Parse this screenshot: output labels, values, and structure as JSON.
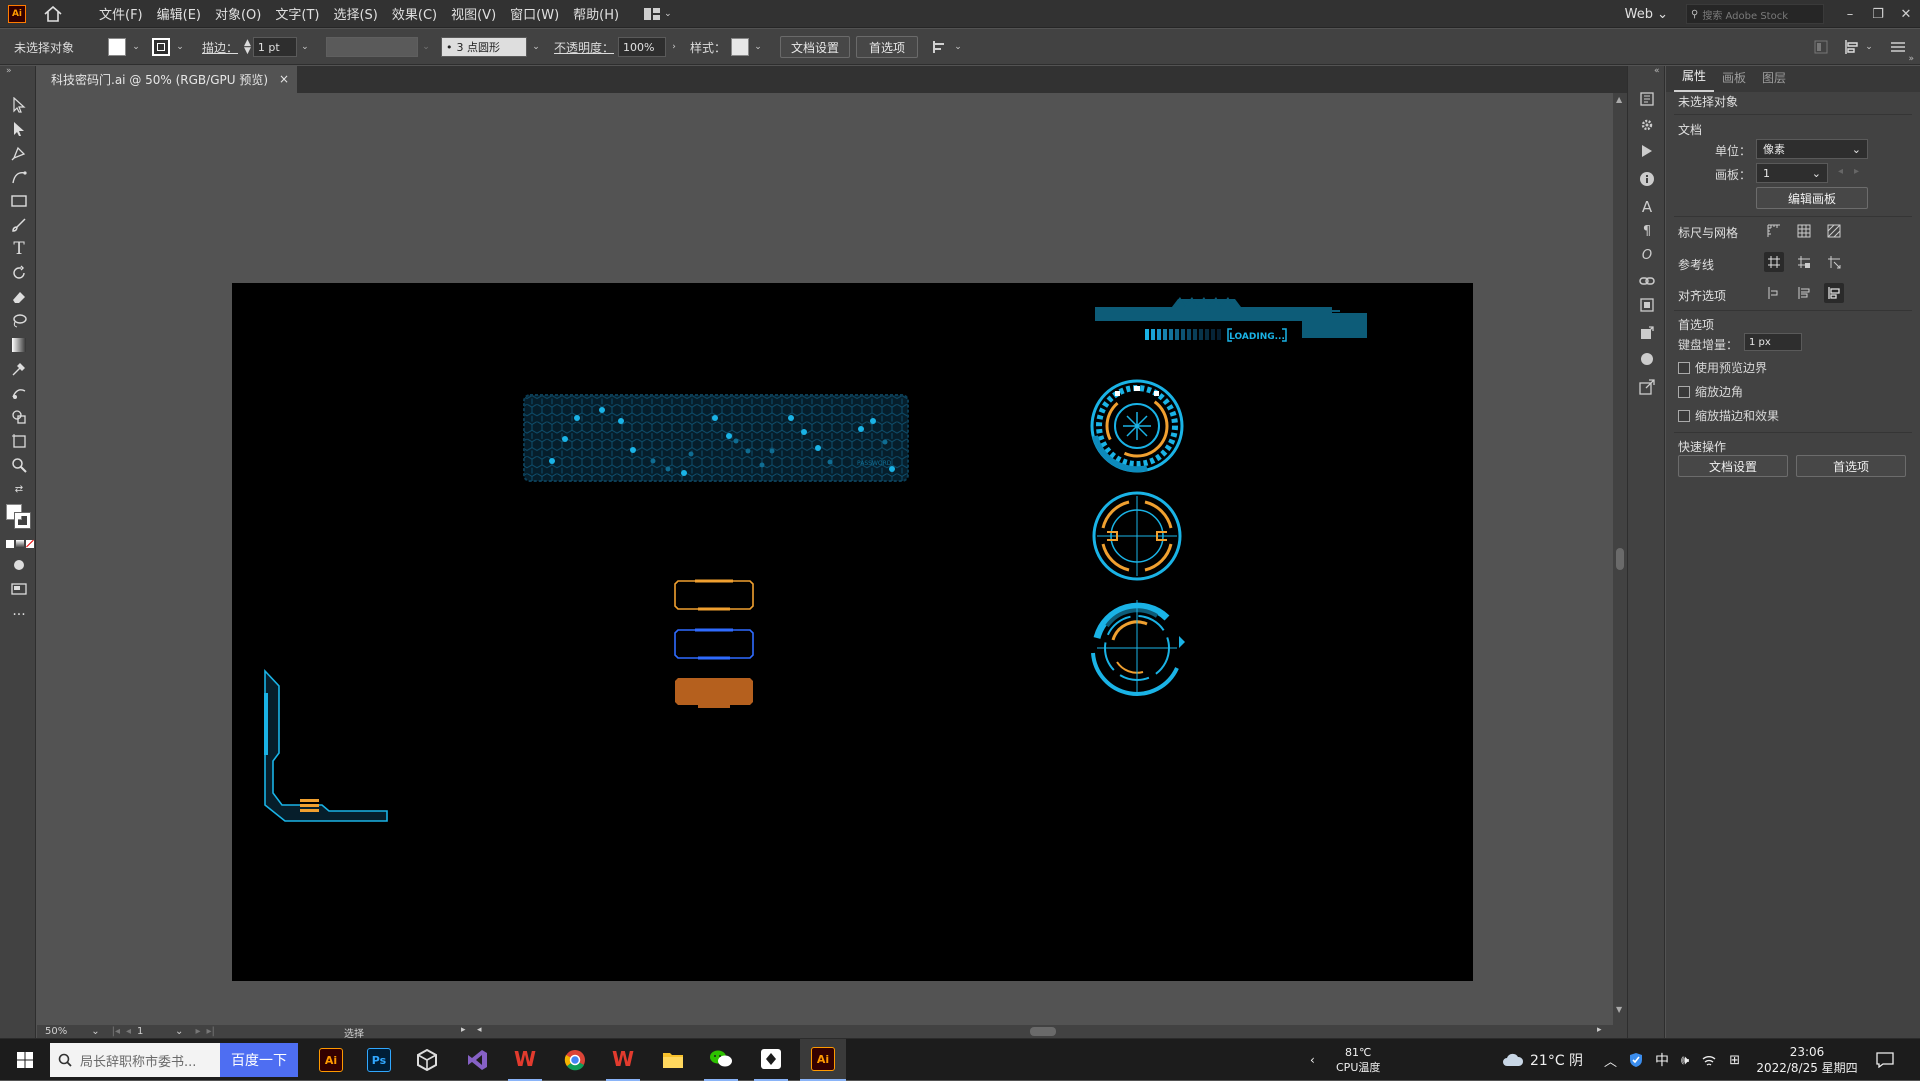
{
  "menubar": {
    "app_icon": "Ai",
    "menus": [
      "文件(F)",
      "编辑(E)",
      "对象(O)",
      "文字(T)",
      "选择(S)",
      "效果(C)",
      "视图(V)",
      "窗口(W)",
      "帮助(H)"
    ],
    "workspace": "Web",
    "search_placeholder": "搜索 Adobe Stock"
  },
  "control_bar": {
    "selection": "未选择对象",
    "stroke_label": "描边：",
    "stroke_value": "1 pt",
    "brush": "3 点圆形",
    "opacity_label": "不透明度：",
    "opacity_value": "100%",
    "style_label": "样式：",
    "doc_setup": "文档设置",
    "prefs": "首选项"
  },
  "document": {
    "tab_title": "科技密码门.ai @ 50% (RGB/GPU 预览)",
    "close_glyph": "×",
    "loading_text": "LOADING...",
    "hex_panel_label": "PASSWORD"
  },
  "status_bar": {
    "zoom": "50%",
    "artboard_num": "1",
    "tool": "选择"
  },
  "panel": {
    "tabs": [
      "属性",
      "画板",
      "图层"
    ],
    "no_selection": "未选择对象",
    "doc_section": "文档",
    "units_label": "单位：",
    "units_value": "像素",
    "artboard_label": "画板：",
    "artboard_value": "1",
    "edit_artboards": "编辑画板",
    "rulers_grids": "标尺与网格",
    "guides": "参考线",
    "align_options": "对齐选项",
    "prefs_section": "首选项",
    "keyboard_inc_label": "键盘增量：",
    "keyboard_inc_value": "1 px",
    "chk_preview_bounds": "使用预览边界",
    "chk_scale_corners": "缩放边角",
    "chk_scale_strokes": "缩放描边和效果",
    "quick_actions": "快速操作",
    "btn_doc_setup": "文档设置",
    "btn_prefs": "首选项"
  },
  "taskbar": {
    "search_placeholder": "局长辞职称市委书...",
    "search_button": "百度一下",
    "cpu_temp": "81℃",
    "cpu_label": "CPU温度",
    "weather": "21°C 阴",
    "ime": "中",
    "time": "23:06",
    "date": "2022/8/25 星期四"
  },
  "colors": {
    "accent_cyan": "#1ab3e6",
    "accent_orange": "#f0a030",
    "orange_fill": "#b5601e",
    "blue_frame": "#2f6bff",
    "artboard": "#000000"
  }
}
